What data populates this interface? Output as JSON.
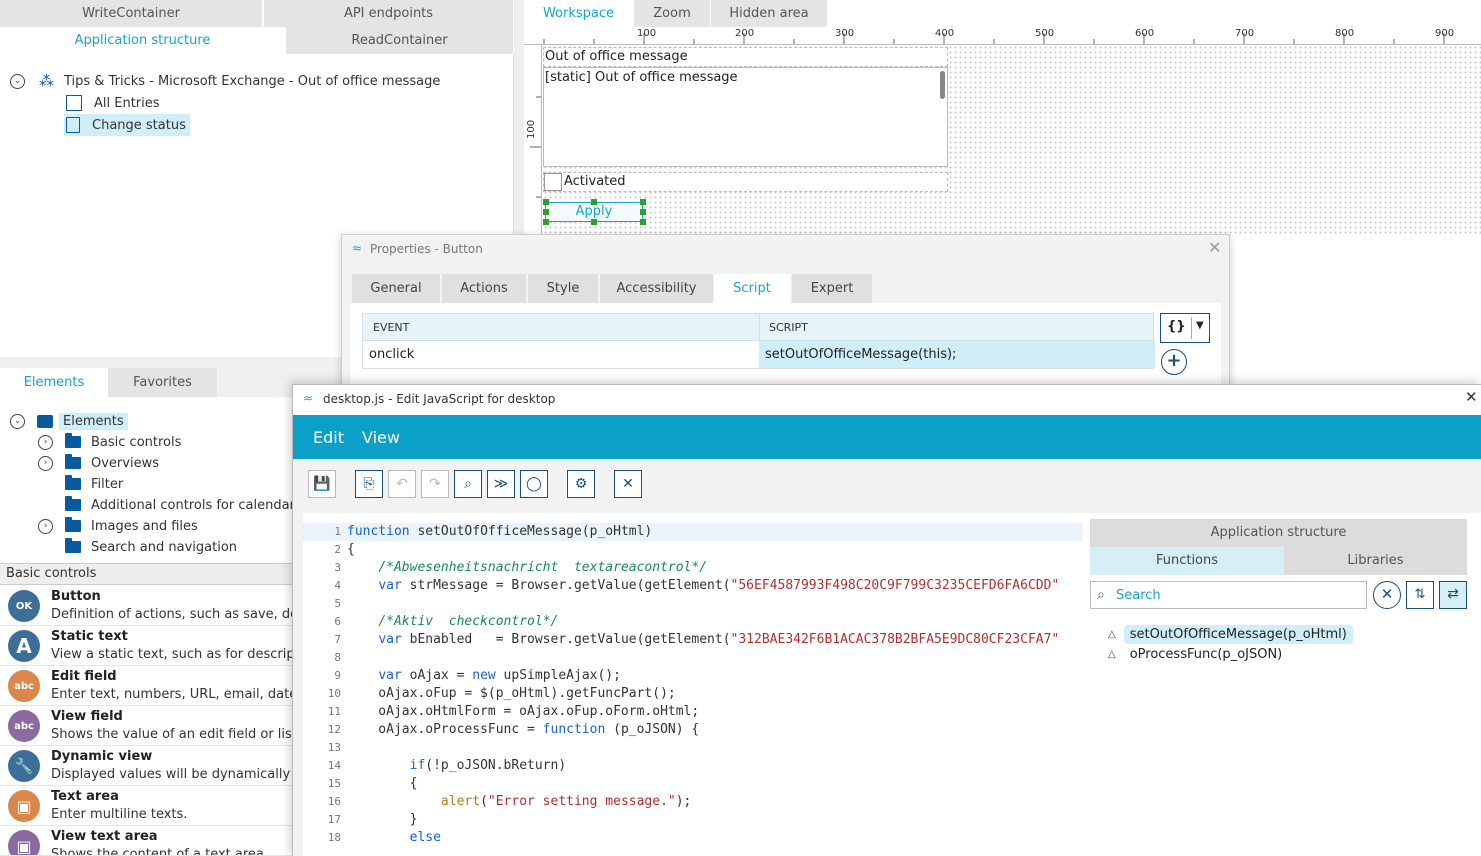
{
  "left_tabs": {
    "row1": [
      "WriteContainer",
      "API endpoints"
    ],
    "row2": [
      "Application structure",
      "ReadContainer"
    ]
  },
  "app_tree": {
    "root": "Tips & Tricks - Microsoft Exchange - Out of office message",
    "children": [
      "All Entries",
      "Change status"
    ],
    "selected": "Change status"
  },
  "elements_tabs": [
    "Elements",
    "Favorites"
  ],
  "elements_tree": {
    "root": "Elements",
    "items": [
      "Basic controls",
      "Overviews",
      "Filter",
      "Additional controls for calendars",
      "Images and files",
      "Search and navigation"
    ]
  },
  "basic_controls": {
    "header": "Basic controls",
    "items": [
      {
        "title": "Button",
        "desc": "Definition of actions, such as save, delete",
        "icon": "ok-icon",
        "glyph": "OK",
        "color": "#3d6e9a"
      },
      {
        "title": "Static text",
        "desc": "View a static text, such as for description",
        "icon": "letter-a-icon",
        "glyph": "A",
        "color": "#3d6e9a"
      },
      {
        "title": "Edit field",
        "desc": "Enter text, numbers, URL, email, date, tim",
        "icon": "abc-field-icon",
        "glyph": "abc",
        "color": "#d9874a"
      },
      {
        "title": "View field",
        "desc": "Shows the value of an edit field or listbox",
        "icon": "abc-field-icon",
        "glyph": "abc",
        "color": "#8a6aa0"
      },
      {
        "title": "Dynamic view",
        "desc": "Displayed values will be dynamically dete",
        "icon": "wrench-icon",
        "glyph": "🔧",
        "color": "#3d6e9a"
      },
      {
        "title": "Text area",
        "desc": "Enter multiline texts.",
        "icon": "textarea-icon",
        "glyph": "▣",
        "color": "#d9874a"
      },
      {
        "title": "View text area",
        "desc": "Shows the content of a text area",
        "icon": "textarea-icon",
        "glyph": "▣",
        "color": "#8a6aa0"
      }
    ]
  },
  "workspace": {
    "tabs": [
      "Workspace",
      "Zoom",
      "Hidden area"
    ],
    "ruler_top": [
      "100",
      "200",
      "300",
      "400",
      "500",
      "600",
      "700",
      "800",
      "900"
    ],
    "ruler_left": [
      "100"
    ],
    "textarea_label": "Out of office message",
    "textarea_value": "[static] Out of office message",
    "checkbox_label": "Activated",
    "button_label": "Apply"
  },
  "properties": {
    "title": "Properties - Button",
    "tabs": [
      "General",
      "Actions",
      "Style",
      "Accessibility",
      "Script",
      "Expert"
    ],
    "active_tab": "Script",
    "columns": [
      "EVENT",
      "SCRIPT"
    ],
    "rows": [
      {
        "event": "onclick",
        "script": "setOutOfOfficeMessage(this);"
      }
    ],
    "braces_label": "{}",
    "add_label": "+"
  },
  "editor": {
    "title": "desktop.js - Edit JavaScript for desktop",
    "menu": [
      "Edit",
      "View"
    ],
    "toolbar": [
      "save-icon",
      "insert-icon",
      "undo-icon",
      "redo-icon",
      "search-icon",
      "next-icon",
      "comment-icon",
      "format-icon",
      "close-editor-icon"
    ],
    "toolbar_glyphs": [
      "💾",
      "⎘",
      "↶",
      "↷",
      "⌕",
      "≫",
      "◯",
      "⚙",
      "✕"
    ],
    "code_lines": [
      "function setOutOfOfficeMessage(p_oHtml)",
      "{",
      "    /*Abwesenheitsnachricht  textareacontrol*/",
      "    var strMessage = Browser.getValue(getElement(\"56EF4587993F498C20C9F799C3235CEFD6FA6CDD\"",
      "",
      "    /*Aktiv  checkcontrol*/",
      "    var bEnabled   = Browser.getValue(getElement(\"312BAE342F6B1ACAC378B2BFA5E9DC80CF23CFA7\"",
      "",
      "    var oAjax = new upSimpleAjax();",
      "    oAjax.oFup = $(p_oHtml).getFuncPart();",
      "    oAjax.oHtmlForm = oAjax.oFup.oForm.oHtml;",
      "    oAjax.oProcessFunc = function (p_oJSON) {",
      "",
      "        if(!p_oJSON.bReturn)",
      "        {",
      "            alert(\"Error setting message.\");",
      "        }",
      "        else"
    ],
    "side": {
      "header": "Application structure",
      "tabs": [
        "Functions",
        "Libraries"
      ],
      "search_placeholder": "Search",
      "functions": [
        "setOutOfOfficeMessage(p_oHtml)",
        "oProcessFunc(p_oJSON)"
      ],
      "selected_function": "setOutOfOfficeMessage(p_oHtml)"
    }
  },
  "colors": {
    "accent": "#1aa3c8",
    "editor_bar": "#0aa0c8",
    "selection": "#cfeef8"
  }
}
